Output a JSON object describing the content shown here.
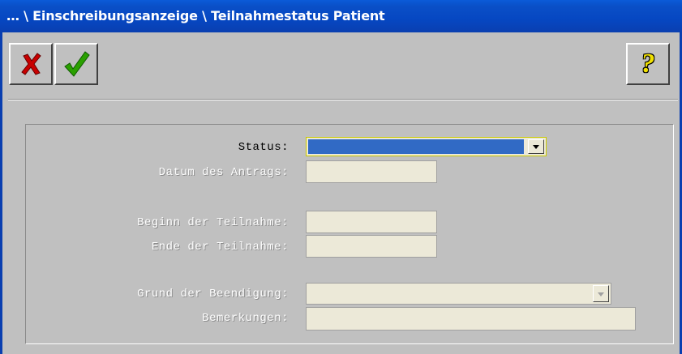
{
  "window": {
    "title": "… \\ Einschreibungsanzeige \\ Teilnahmestatus Patient"
  },
  "toolbar": {
    "cancel_icon": "red-x-icon",
    "confirm_icon": "green-check-icon",
    "help_icon": "yellow-question-mark-icon",
    "help_glyph": "?"
  },
  "form": {
    "status": {
      "label": "Status:",
      "value": ""
    },
    "datum_antrag": {
      "label": "Datum des Antrags:",
      "value": ""
    },
    "beginn_teilnahme": {
      "label": "Beginn der Teilnahme:",
      "value": ""
    },
    "ende_teilnahme": {
      "label": "Ende der Teilnahme:",
      "value": ""
    },
    "grund_beendigung": {
      "label": "Grund der Beendigung:",
      "value": ""
    },
    "bemerkungen": {
      "label": "Bemerkungen:",
      "value": ""
    }
  },
  "colors": {
    "titlebar": "#0a4fc7",
    "selection": "#316ac5",
    "background": "#c0c0c0",
    "field": "#ece9d8"
  }
}
